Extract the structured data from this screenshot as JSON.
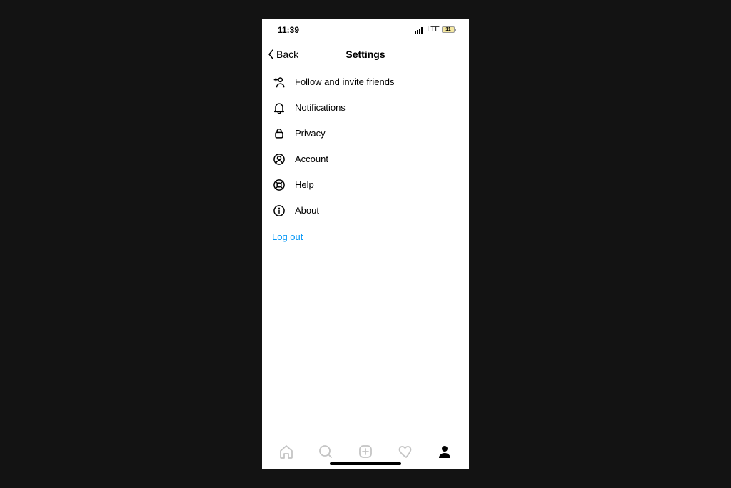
{
  "status": {
    "time": "11:39",
    "network": "LTE",
    "battery": "11"
  },
  "nav": {
    "back": "Back",
    "title": "Settings"
  },
  "menu": {
    "items": [
      {
        "label": "Follow and invite friends",
        "icon": "person-add"
      },
      {
        "label": "Notifications",
        "icon": "bell"
      },
      {
        "label": "Privacy",
        "icon": "lock"
      },
      {
        "label": "Account",
        "icon": "account-circle"
      },
      {
        "label": "Help",
        "icon": "help-ring"
      },
      {
        "label": "About",
        "icon": "info"
      }
    ]
  },
  "logout": {
    "label": "Log out"
  },
  "tabs": {
    "items": [
      {
        "name": "home",
        "active": false
      },
      {
        "name": "search",
        "active": false
      },
      {
        "name": "create",
        "active": false
      },
      {
        "name": "activity",
        "active": false
      },
      {
        "name": "profile",
        "active": true
      }
    ]
  },
  "colors": {
    "link": "#0095f6",
    "inactive": "#c4c4c4",
    "active": "#000000"
  }
}
